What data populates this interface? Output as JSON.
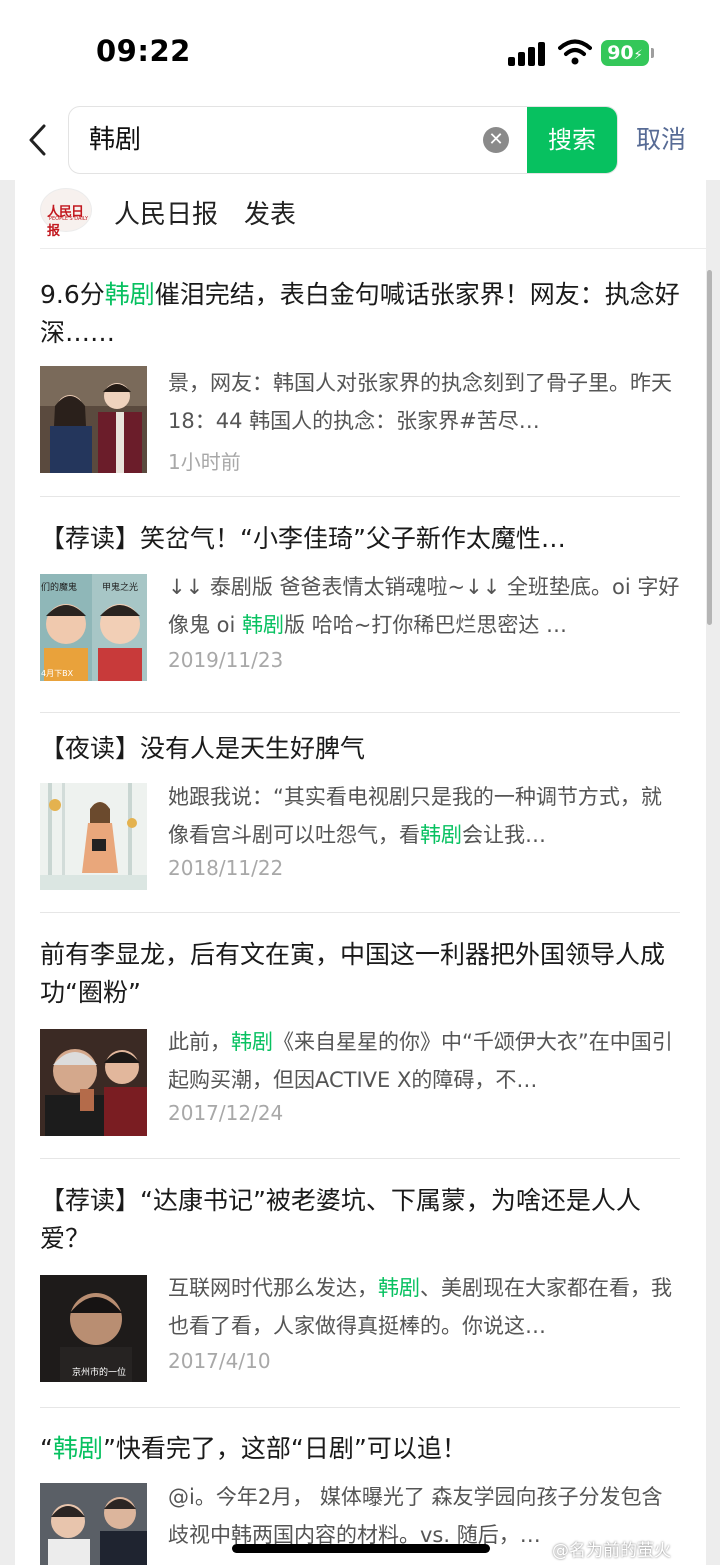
{
  "status_bar": {
    "time": "09:22",
    "battery": "90",
    "battery_icon": "battery-charging-icon",
    "icons": [
      "signal-icon",
      "wifi-icon"
    ]
  },
  "search": {
    "query": "韩剧",
    "search_button": "搜索",
    "cancel": "取消",
    "clear_icon": "clear-icon",
    "back_icon": "back-chevron-icon"
  },
  "publisher": {
    "logo_text": "人民日报",
    "logo_subtext": "PEOPLE'S DAILY",
    "name": "人民日报",
    "suffix": "发表"
  },
  "highlight_color": "#07c160",
  "articles": [
    {
      "title_parts": [
        {
          "t": "9.6分",
          "hl": false
        },
        {
          "t": "韩剧",
          "hl": true
        },
        {
          "t": "催泪完结，表白金句喊话张家界！网友：执念好深……",
          "hl": false
        }
      ],
      "snippet_parts": [
        {
          "t": "景，网友：韩国人对张家界的执念刻到了骨子里。昨天18：44 韩国人的执念：张家界#苦尽…",
          "hl": false
        }
      ],
      "date": "1小时前"
    },
    {
      "title_parts": [
        {
          "t": "【荐读】笑岔气！“小李佳琦”父子新作太魔性…",
          "hl": false
        }
      ],
      "snippet_parts": [
        {
          "t": "↓↓ 泰剧版 爸爸表情太销魂啦~↓↓ 全班垫底。oi 字好像鬼 oi ",
          "hl": false
        },
        {
          "t": "韩剧",
          "hl": true
        },
        {
          "t": "版 哈哈~打你稀巴烂思密达 …",
          "hl": false
        }
      ],
      "date": "2019/11/23",
      "thumb_labels": [
        "们的魔鬼",
        "甲鬼之光",
        "4月下BX"
      ]
    },
    {
      "title_parts": [
        {
          "t": "【夜读】没有人是天生好脾气",
          "hl": false
        }
      ],
      "snippet_parts": [
        {
          "t": "她跟我说：“其实看电视剧只是我的一种调节方式，就像看宫斗剧可以吐怨气，看",
          "hl": false
        },
        {
          "t": "韩剧",
          "hl": true
        },
        {
          "t": "会让我…",
          "hl": false
        }
      ],
      "date": "2018/11/22"
    },
    {
      "title_parts": [
        {
          "t": "前有李显龙，后有文在寅，中国这一利器把外国领导人成功“圈粉”",
          "hl": false
        }
      ],
      "snippet_parts": [
        {
          "t": "此前，",
          "hl": false
        },
        {
          "t": "韩剧",
          "hl": true
        },
        {
          "t": "《来自星星的你》中“千颂伊大衣”在中国引起购买潮，但因ACTIVE X的障碍，不…",
          "hl": false
        }
      ],
      "date": "2017/12/24"
    },
    {
      "title_parts": [
        {
          "t": "【荐读】“达康书记”被老婆坑、下属蒙，为啥还是人人爱？",
          "hl": false
        }
      ],
      "snippet_parts": [
        {
          "t": "互联网时代那么发达，",
          "hl": false
        },
        {
          "t": "韩剧",
          "hl": true
        },
        {
          "t": "、美剧现在大家都在看，我也看了看，人家做得真挺棒的。你说这…",
          "hl": false
        }
      ],
      "date": "2017/4/10",
      "thumb_labels": [
        "京州市的一位"
      ]
    },
    {
      "title_parts": [
        {
          "t": "“",
          "hl": false
        },
        {
          "t": "韩剧",
          "hl": true
        },
        {
          "t": "”快看完了，这部“日剧”可以追！",
          "hl": false
        }
      ],
      "snippet_parts": [
        {
          "t": "@i。今年2月， 媒体曝光了 森友学园向孩子分发包含 歧视中韩两国内容的材料。vs. 随后，…",
          "hl": false
        }
      ],
      "date": ""
    }
  ],
  "watermark": "@名为前的萤火"
}
